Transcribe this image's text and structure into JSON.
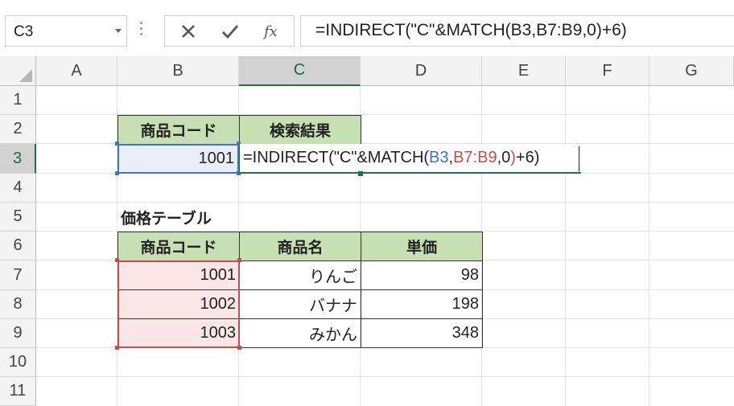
{
  "name_box": "C3",
  "formula_bar": "=INDIRECT(\"C\"&MATCH(B3,B7:B9,0)+6)",
  "columns": [
    "A",
    "B",
    "C",
    "D",
    "E",
    "F",
    "G"
  ],
  "rows": [
    "1",
    "2",
    "3",
    "4",
    "5",
    "6",
    "7",
    "8",
    "9",
    "10",
    "11"
  ],
  "search": {
    "header_code": "商品コード",
    "header_result": "検索結果",
    "code_value": "1001",
    "formula_parts": [
      "=INDIRECT(\"C\"&MATCH(",
      "B3",
      ",",
      "B7:B9",
      ",0",
      ")",
      "+6)"
    ]
  },
  "table_title": "価格テーブル",
  "table": {
    "headers": [
      "商品コード",
      "商品名",
      "単価"
    ],
    "rows": [
      {
        "code": "1001",
        "name": "りんご",
        "price": "98"
      },
      {
        "code": "1002",
        "name": "バナナ",
        "price": "198"
      },
      {
        "code": "1003",
        "name": "みかん",
        "price": "348"
      }
    ]
  },
  "colors": {
    "header_fill": "#c6e0b4",
    "ref_blue": "#4472c4",
    "ref_red": "#c0504d",
    "selection_green": "#217346"
  },
  "icons": [
    "close-icon",
    "check-icon",
    "fx-icon",
    "chevron-down-icon"
  ]
}
